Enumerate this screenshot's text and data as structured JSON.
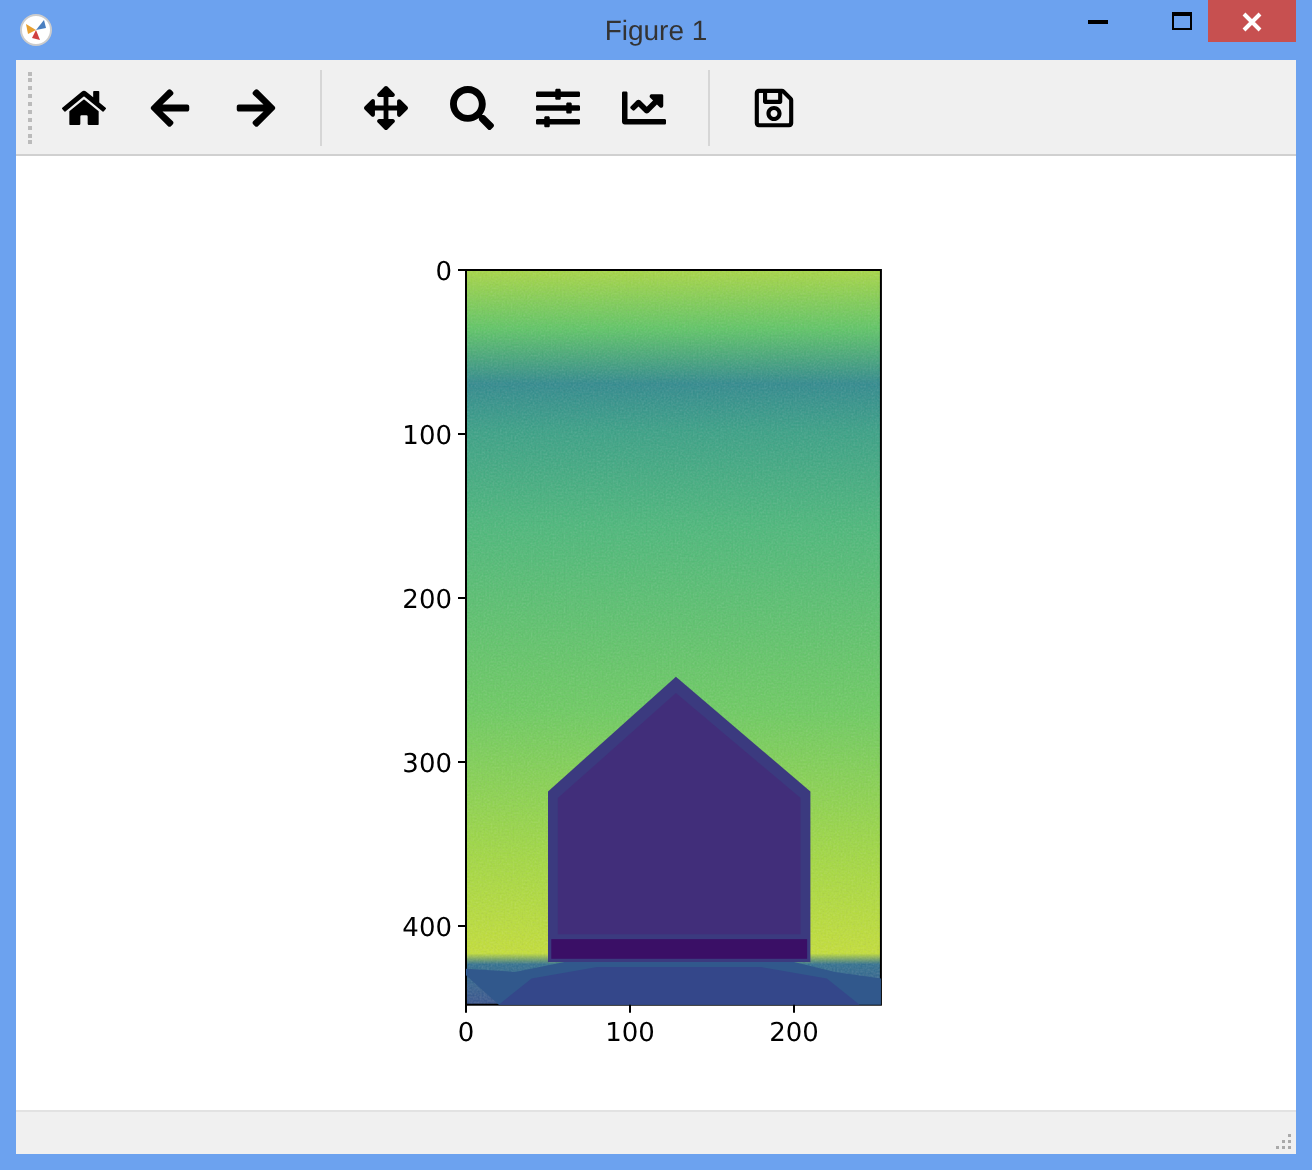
{
  "window": {
    "title": "Figure 1"
  },
  "toolbar": {
    "groups": [
      [
        {
          "kind": "home"
        },
        {
          "kind": "back"
        },
        {
          "kind": "forward"
        }
      ],
      [
        {
          "kind": "pan"
        },
        {
          "kind": "zoom"
        },
        {
          "kind": "configure"
        },
        {
          "kind": "edit"
        }
      ],
      [
        {
          "kind": "save"
        }
      ]
    ]
  },
  "plot": {
    "x_ticks": [
      "0",
      "100",
      "200"
    ],
    "y_ticks": [
      "0",
      "100",
      "200",
      "300",
      "400"
    ]
  }
}
